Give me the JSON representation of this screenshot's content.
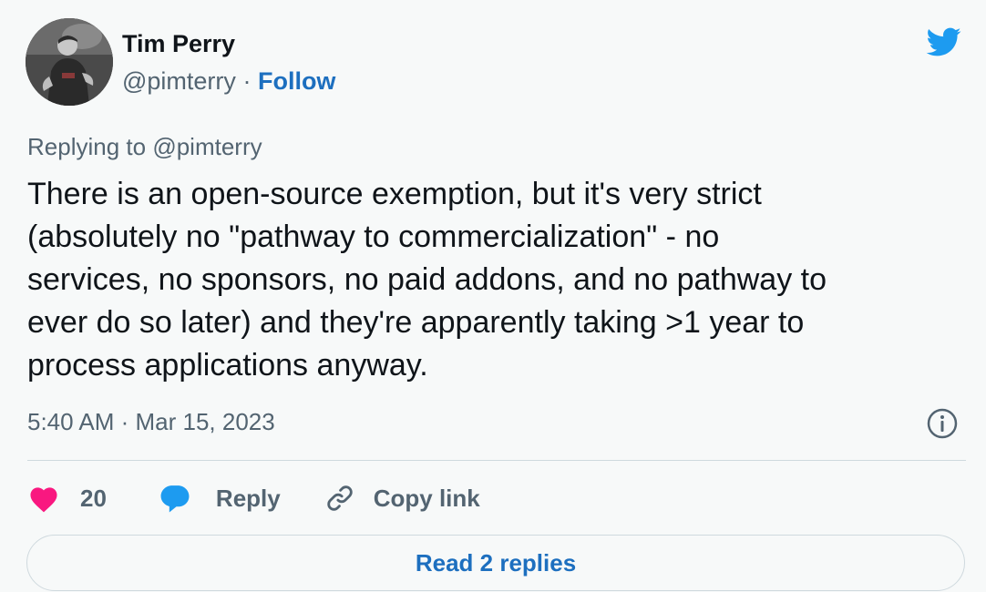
{
  "author": {
    "name": "Tim Perry",
    "handle": "@pimterry",
    "separator": "·",
    "follow_label": "Follow",
    "avatar_icon": "profile-photo"
  },
  "brand": {
    "icon": "twitter-bird-icon",
    "color": "#1d9bf0"
  },
  "tweet": {
    "replying_prefix": "Replying to",
    "replying_to": "@pimterry",
    "text_lines": [
      "There is an open-source exemption, but it's very strict",
      "(absolutely no \"pathway to commercialization\" - no",
      "services, no sponsors, no paid addons, and no pathway to",
      "ever do so later) and they're apparently taking >1 year to",
      "process applications anyway."
    ],
    "timestamp": "5:40 AM · Mar 15, 2023",
    "info_icon": "info-icon"
  },
  "actions": {
    "like_count": "20",
    "like_color": "#f91880",
    "reply_label": "Reply",
    "reply_color": "#1d9bf0",
    "copy_link_label": "Copy link"
  },
  "footer": {
    "read_replies_label": "Read 2 replies"
  },
  "colors": {
    "background": "#f7f9f9",
    "link": "#1d6fbf",
    "secondary_text": "#536471",
    "primary_text": "#0f1419"
  }
}
